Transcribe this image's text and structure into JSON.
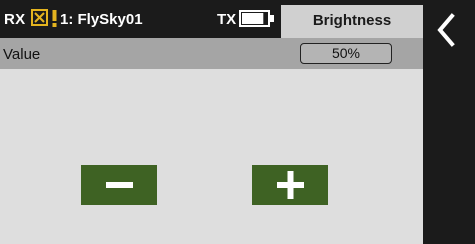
{
  "header": {
    "rx_label": "RX",
    "model_name": "1: FlySky01",
    "tx_label": "TX",
    "tx_battery_level": 0.85,
    "title": "Brightness",
    "accent_color": "#e4b41f"
  },
  "back_button": {
    "icon": "chevron-left-icon"
  },
  "setting": {
    "label": "Value",
    "value": "50%"
  },
  "controls": {
    "decrease_icon": "minus-icon",
    "increase_icon": "plus-icon",
    "button_color": "#3e6223"
  }
}
